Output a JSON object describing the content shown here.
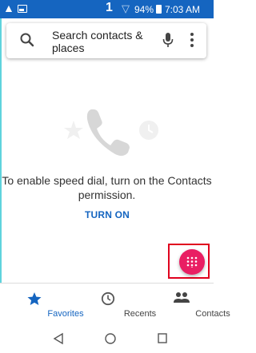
{
  "status_bar": {
    "sim_slot": "1",
    "battery": "94%",
    "time": "7:03 AM"
  },
  "search": {
    "placeholder": "Search contacts & places"
  },
  "empty_state": {
    "message": "To enable speed dial, turn on the Contacts permission.",
    "action_label": "TURN ON"
  },
  "fab": {
    "icon": "dialpad-icon"
  },
  "bottom_nav": {
    "items": [
      {
        "label": "Favorites",
        "icon": "star-icon",
        "active": true
      },
      {
        "label": "Recents",
        "icon": "clock-icon",
        "active": false
      },
      {
        "label": "Contacts",
        "icon": "people-icon",
        "active": false
      }
    ]
  },
  "colors": {
    "status_bar": "#1565c0",
    "accent": "#1565c0",
    "fab": "#e91e63",
    "highlight": "#e0001e",
    "active_tab": "#1565c0"
  }
}
